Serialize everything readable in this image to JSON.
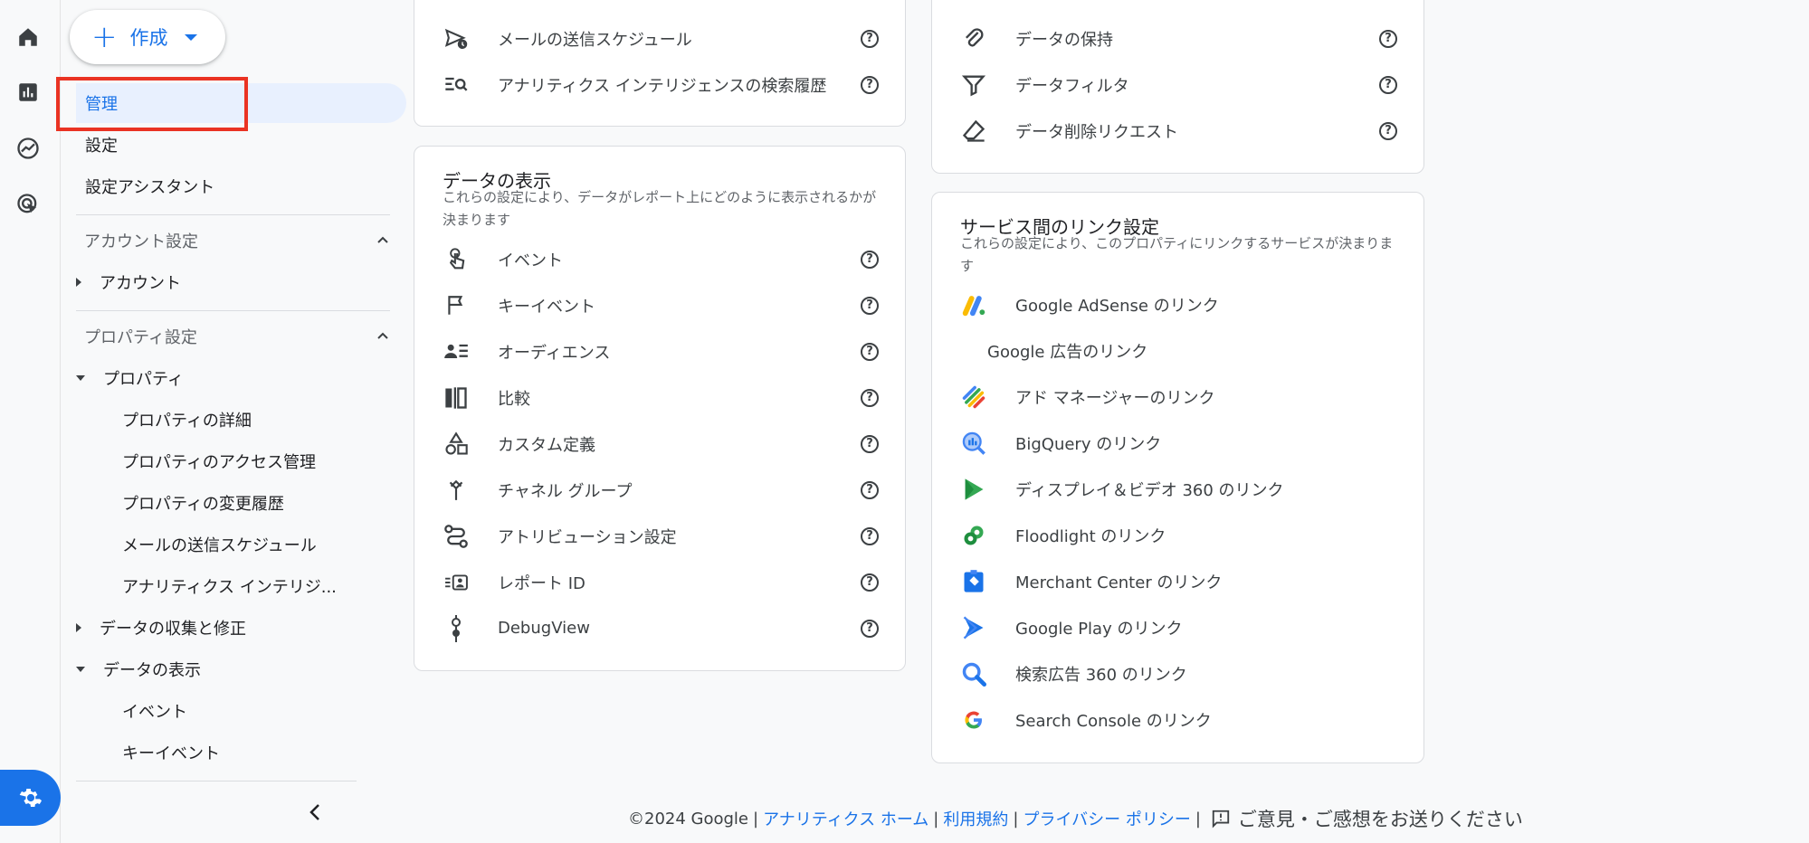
{
  "create": {
    "label": "作成"
  },
  "nav": {
    "admin": "管理",
    "settings": "設定",
    "setup_assistant": "設定アシスタント",
    "account_settings": "アカウント設定",
    "account": "アカウント",
    "property_settings": "プロパティ設定",
    "property": "プロパティ",
    "property_details": "プロパティの詳細",
    "property_access": "プロパティのアクセス管理",
    "property_history": "プロパティの変更履歴",
    "email_schedule": "メールの送信スケジュール",
    "analytics_intelligence": "アナリティクス インテリジ...",
    "data_collection": "データの収集と修正",
    "data_display": "データの表示",
    "events": "イベント",
    "key_events": "キーイベント"
  },
  "card_top_left": {
    "rows": [
      "メールの送信スケジュール",
      "アナリティクス インテリジェンスの検索履歴"
    ]
  },
  "card_top_right": {
    "rows": [
      "データの保持",
      "データフィルタ",
      "データ削除リクエスト"
    ]
  },
  "card_data_display": {
    "title": "データの表示",
    "desc": "これらの設定により、データがレポート上にどのように表示されるかが決まります",
    "rows": [
      "イベント",
      "キーイベント",
      "オーディエンス",
      "比較",
      "カスタム定義",
      "チャネル グループ",
      "アトリビューション設定",
      "レポート ID",
      "DebugView"
    ]
  },
  "card_links": {
    "title": "サービス間のリンク設定",
    "desc": "これらの設定により、このプロパティにリンクするサービスが決まります",
    "rows": [
      "Google AdSense のリンク",
      "Google 広告のリンク",
      "アド マネージャーのリンク",
      "BigQuery のリンク",
      "ディスプレイ＆ビデオ 360 のリンク",
      "Floodlight のリンク",
      "Merchant Center のリンク",
      "Google Play のリンク",
      "検索広告 360 のリンク",
      "Search Console のリンク"
    ]
  },
  "help_glyph": "?",
  "footer": {
    "copyright": "©2024 Google",
    "home": "アナリティクス ホーム",
    "terms": "利用規約",
    "privacy": "プライバシー ポリシー",
    "feedback": "ご意見・ご感想をお送りください",
    "separator": "|"
  },
  "colors": {
    "accent": "#1a73e8",
    "highlight": "#ea3323",
    "active_bg": "#e8f0fe"
  }
}
